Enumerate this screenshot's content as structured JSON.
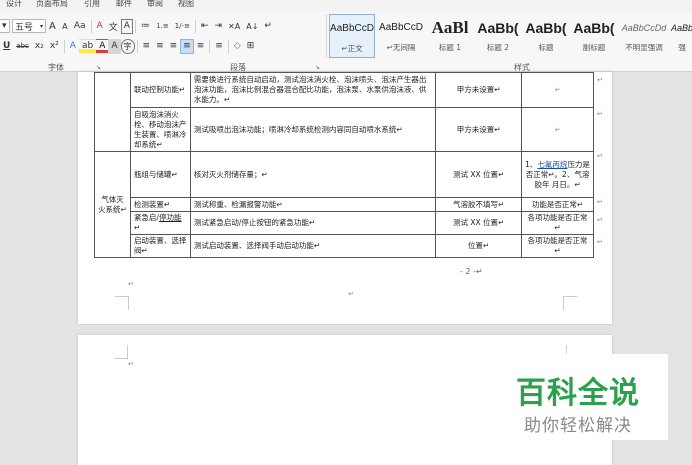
{
  "tabs": [
    "设计",
    "页面布局",
    "引用",
    "邮件",
    "审阅",
    "视图"
  ],
  "font": {
    "size": "五号",
    "grow": "A",
    "shrink": "A",
    "case": "Aa",
    "clear": "A",
    "pinyin": "文",
    "border_char": "A",
    "underline": "U",
    "strike": "abc",
    "sub": "x₂",
    "sup": "x²",
    "effects": "A",
    "highlight": "ab",
    "color": "A",
    "shade": "A",
    "circle": "字"
  },
  "paragraph": {
    "bullets": "≔",
    "numbering": "⒈≡",
    "multilevel": "1/-≡",
    "dec_indent": "⇤",
    "inc_indent": "⇥",
    "chinese_layout": "✕A",
    "sort": "A↓",
    "show_marks": "↵",
    "align_left": "≡",
    "center": "≡",
    "align_right": "≡",
    "justify": "≡",
    "distributed": "≡",
    "line_spacing": "≡",
    "shading": "◇",
    "borders": "⊞"
  },
  "groups": {
    "font": "字体",
    "paragraph": "段落",
    "styles": "样式"
  },
  "styles": [
    {
      "sample": "AaBbCcD",
      "name": "↵正文",
      "selected": true
    },
    {
      "sample": "AaBbCcD",
      "name": "↵无间隔",
      "selected": false
    },
    {
      "sample": "AaBl",
      "name": "标题 1",
      "selected": false
    },
    {
      "sample": "AaBb(",
      "name": "标题 2",
      "selected": false
    },
    {
      "sample": "AaBb(",
      "name": "标题",
      "selected": false
    },
    {
      "sample": "AaBb(",
      "name": "副标题",
      "selected": false
    },
    {
      "sample": "AaBbCcDd",
      "name": "不明显强调",
      "selected": false
    },
    {
      "sample": "AaBb",
      "name": "强",
      "selected": false
    }
  ],
  "table": {
    "rows": [
      {
        "c2": "联动控制功能↵",
        "c3": "需要换进行系统自动启动，测试泡沫消火栓、泡沫喷头、泡沫产生器出泡沫功能，泡沫比例混合器混合配比功能，泡沫泵、水泵供泡沫液、供水能力。↵",
        "c4": "甲方未设置↵",
        "c5": "↵"
      },
      {
        "c2": "自吸泡沫消火栓、移动泡沫产生装置、喷淋冷却系统↵",
        "c3": "测试吸喷出泡沫功能；喷淋冷却系统检测内容同自动喷水系统↵",
        "c4": "甲方未设置↵",
        "c5": "↵"
      },
      {
        "c1": "气体灭火系统↵",
        "c2": "瓶组与储罐↵",
        "c3": "核对灭火剂储存量；↵",
        "c4": "测试 XX 位置↵",
        "c5a": "1、",
        "c5b": "七氟丙烷",
        "c5c": "压力是否正常↵。2、气溶胶年 月日。↵"
      },
      {
        "c2": "检测装置↵",
        "c3": "测试称重、检漏报警功能↵",
        "c4": "气溶胶不填写↵",
        "c5": "功能是否正常↵"
      },
      {
        "c2a": "紧急启/",
        "c2b": "停功能",
        "c2c": "↵",
        "c3": "测试紧急启动/停止按钮的紧急功能↵",
        "c4": "测试 XX 位置↵",
        "c5": "各项功能是否正常↵"
      },
      {
        "c2": "启动装置、选择阀↵",
        "c3": "测试启动装置、选择阀手动启动功能↵",
        "c4": "位置↵",
        "c5": "各项功能是否正常↵"
      }
    ]
  },
  "page_number": "- 2 -↵",
  "marks": {
    "para": "↵"
  },
  "watermark": {
    "title": "百科全说",
    "subtitle": "助你轻松解决"
  }
}
